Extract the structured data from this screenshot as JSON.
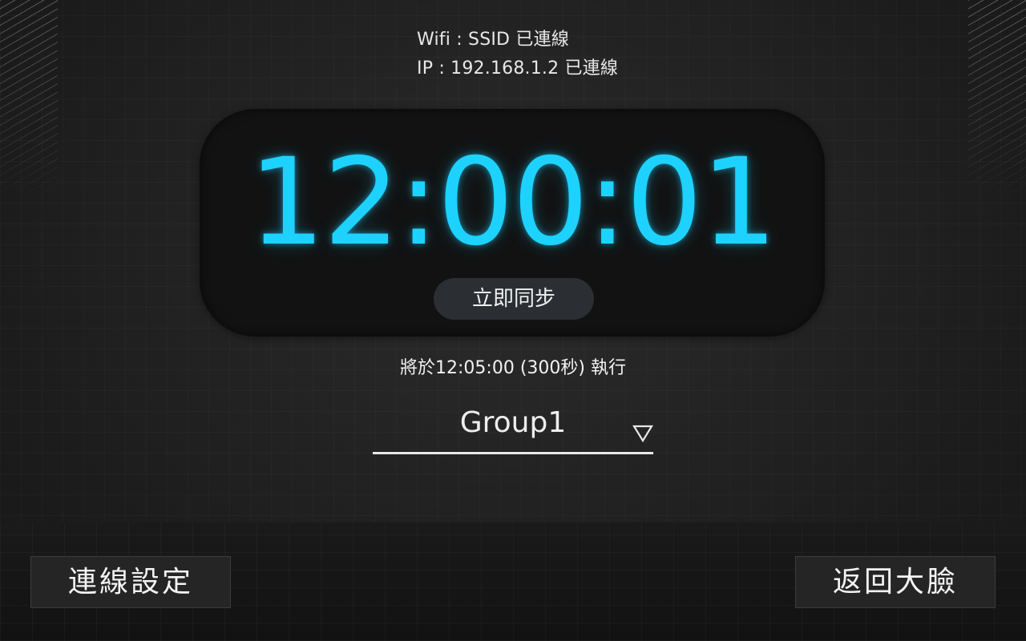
{
  "status": {
    "wifi_line": "Wifi : SSID  已連線",
    "ip_line": "IP : 192.168.1.2  已連線"
  },
  "clock": {
    "time": "12:00:01",
    "accent_color": "#1ed2ff",
    "sync_label": "立即同步"
  },
  "schedule": {
    "text": "將於12:05:00 (300秒) 執行"
  },
  "group_select": {
    "value": "Group1",
    "icon": "triangle-down-icon"
  },
  "footer": {
    "connection_settings_label": "連線設定",
    "back_label": "返回大臉"
  }
}
